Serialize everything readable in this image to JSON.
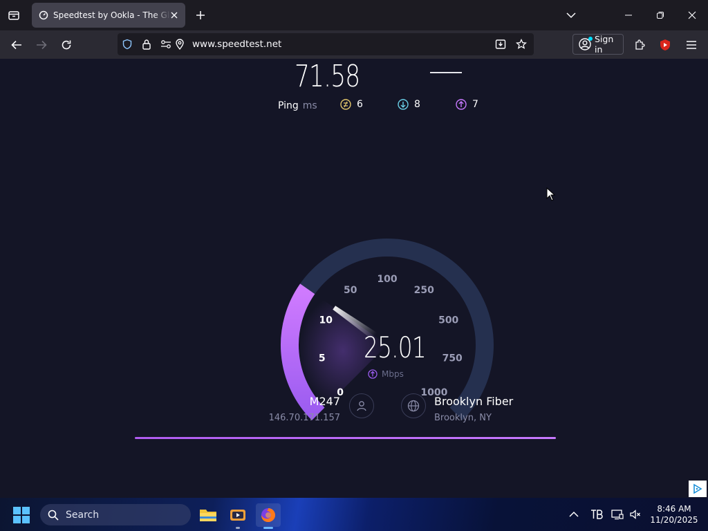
{
  "browser": {
    "tab_title": "Speedtest by Ookla - The Global Broadband Speed Test",
    "url": "www.speedtest.net",
    "sign_in_label": "Sign in",
    "icons": [
      "tab-list-icon",
      "speedtest-favicon",
      "close-icon",
      "plus-icon",
      "chevron-down-icon",
      "minimize-icon",
      "restore-icon",
      "close-window-icon",
      "back-icon",
      "forward-icon",
      "reload-icon",
      "shield-icon",
      "lock-icon",
      "permissions-icon",
      "location-icon",
      "download-page-icon",
      "star-icon",
      "account-icon",
      "extensions-icon",
      "youtube-extension-icon",
      "menu-icon"
    ]
  },
  "results": {
    "download_value": "71.58",
    "upload_placeholder": "—",
    "ping_label": "Ping",
    "ping_unit": "ms",
    "ping_idle": "6",
    "ping_download": "8",
    "ping_upload": "7"
  },
  "gauge": {
    "value": "25.01",
    "unit": "Mbps",
    "current_speed": 25.01,
    "scale_labels": [
      "0",
      "5",
      "10",
      "50",
      "100",
      "250",
      "500",
      "750",
      "1000"
    ],
    "accent_color": "#c879ff",
    "track_color": "#25304f"
  },
  "connection": {
    "host_name": "M247",
    "host_ip": "146.70.171.157",
    "isp_name": "Brooklyn Fiber",
    "isp_location": "Brooklyn, NY"
  },
  "taskbar": {
    "search_label": "Search",
    "time": "8:46 AM",
    "date": "11/20/2025"
  }
}
